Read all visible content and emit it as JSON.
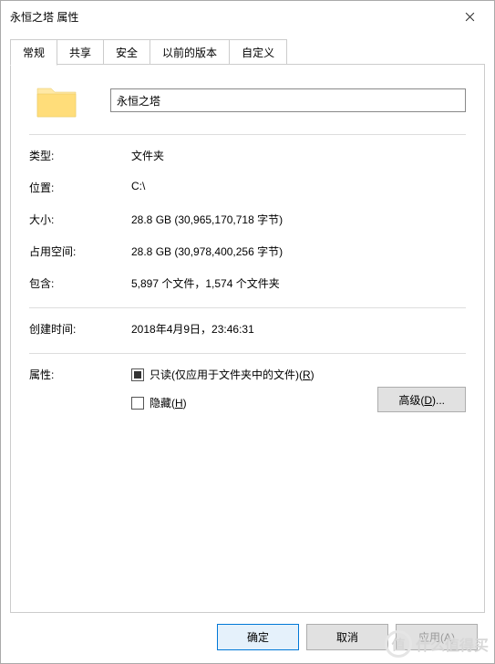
{
  "title": "永恒之塔 属性",
  "tabs": {
    "general": "常规",
    "sharing": "共享",
    "security": "安全",
    "previous": "以前的版本",
    "custom": "自定义"
  },
  "name_value": "永恒之塔",
  "labels": {
    "type": "类型:",
    "location": "位置:",
    "size": "大小:",
    "size_on_disk": "占用空间:",
    "contains": "包含:",
    "created": "创建时间:",
    "attributes": "属性:"
  },
  "values": {
    "type": "文件夹",
    "location": "C:\\",
    "size": "28.8 GB (30,965,170,718 字节)",
    "size_on_disk": "28.8 GB (30,978,400,256 字节)",
    "contains": "5,897 个文件，1,574 个文件夹",
    "created": "2018年4月9日，23:46:31"
  },
  "readonly_label_pre": "只读(仅应用于文件夹中的文件)(",
  "readonly_key": "R",
  "readonly_label_post": ")",
  "hidden_label_pre": "隐藏(",
  "hidden_key": "H",
  "hidden_label_post": ")",
  "advanced_pre": "高级(",
  "advanced_key": "D",
  "advanced_post": ")...",
  "buttons": {
    "ok": "确定",
    "cancel": "取消",
    "apply": "应用(A)"
  },
  "watermark": {
    "char": "值",
    "text": "什么值得买"
  }
}
